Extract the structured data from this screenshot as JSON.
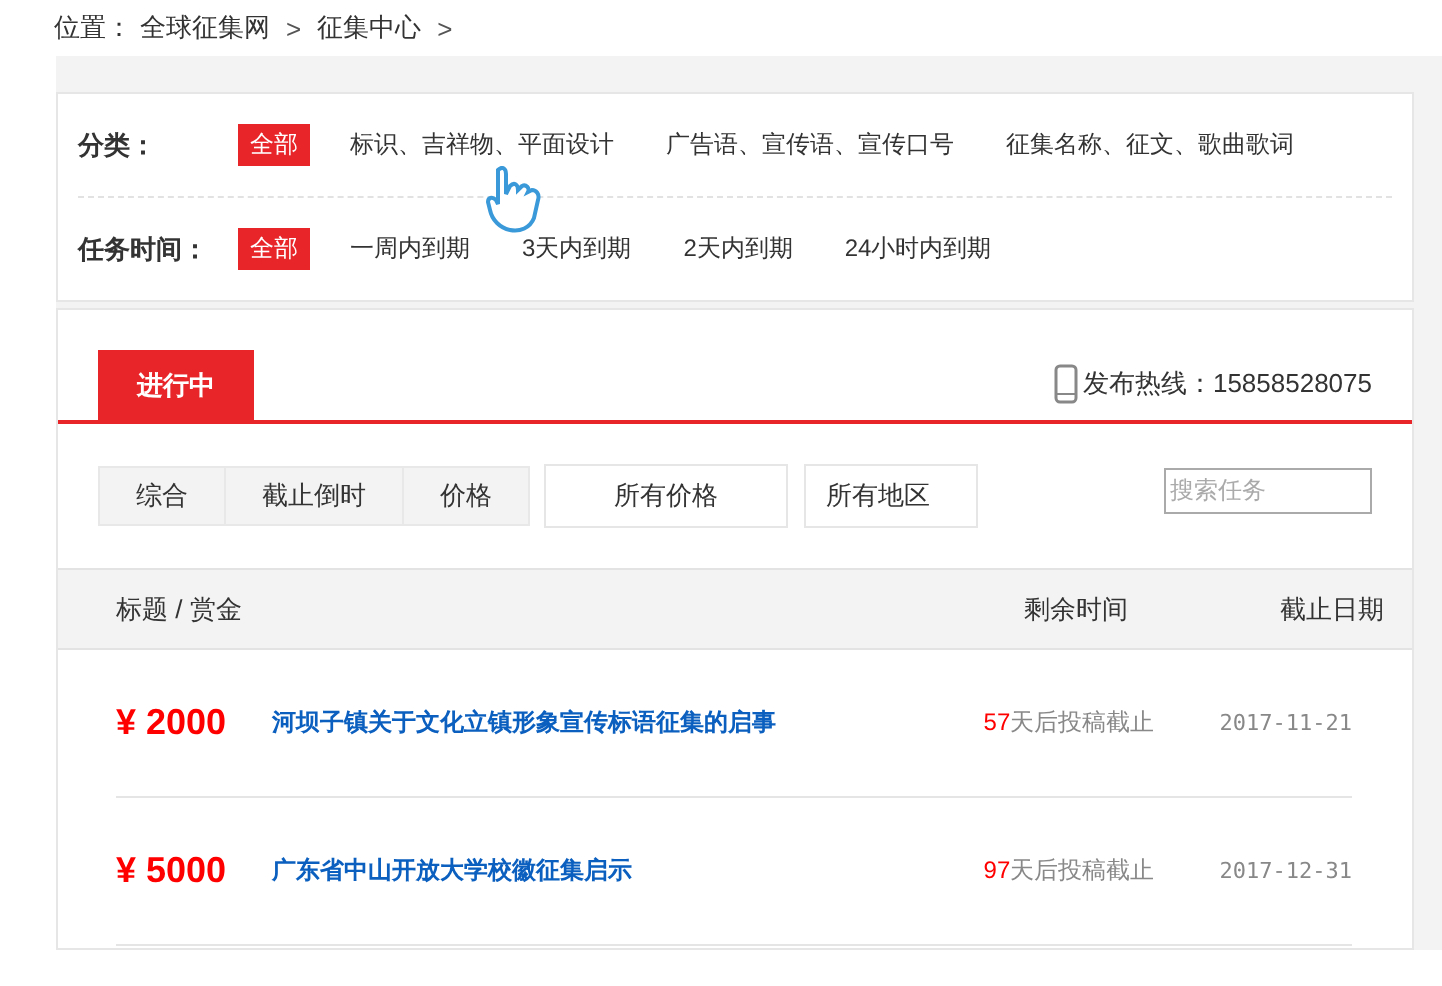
{
  "breadcrumb": {
    "label": "位置：",
    "items": [
      {
        "text": "全球征集网",
        "separator": ">"
      },
      {
        "text": "征集中心",
        "separator": ">"
      }
    ]
  },
  "filters": [
    {
      "label": "分类：",
      "options": [
        {
          "text": "全部",
          "selected": true
        },
        {
          "text": "标识、吉祥物、平面设计",
          "selected": false
        },
        {
          "text": "广告语、宣传语、宣传口号",
          "selected": false
        },
        {
          "text": "征集名称、征文、歌曲歌词",
          "selected": false
        }
      ]
    },
    {
      "label": "任务时间：",
      "options": [
        {
          "text": "全部",
          "selected": true
        },
        {
          "text": "一周内到期",
          "selected": false
        },
        {
          "text": "3天内到期",
          "selected": false
        },
        {
          "text": "2天内到期",
          "selected": false
        },
        {
          "text": "24小时内到期",
          "selected": false
        }
      ]
    }
  ],
  "tabs": [
    {
      "label": "进行中",
      "selected": true
    }
  ],
  "hotline": "发布热线：15858528075",
  "sort_buttons": [
    "综合",
    "截止倒时",
    "价格"
  ],
  "dropdowns": [
    "所有价格",
    "所有地区"
  ],
  "search": {
    "placeholder": "搜索任务"
  },
  "table": {
    "columns": [
      "标题 / 赏金",
      "剩余时间",
      "截止日期"
    ],
    "rows": [
      {
        "reward": "¥ 2000",
        "title": "河坝子镇关于文化立镇形象宣传标语征集的启事",
        "days": "57",
        "days_suffix": "天后投稿截止",
        "deadline": "2017-11-21"
      },
      {
        "reward": "¥ 5000",
        "title": "广东省中山开放大学校徽征集启示",
        "days": "97",
        "days_suffix": "天后投稿截止",
        "deadline": "2017-12-31"
      }
    ]
  }
}
